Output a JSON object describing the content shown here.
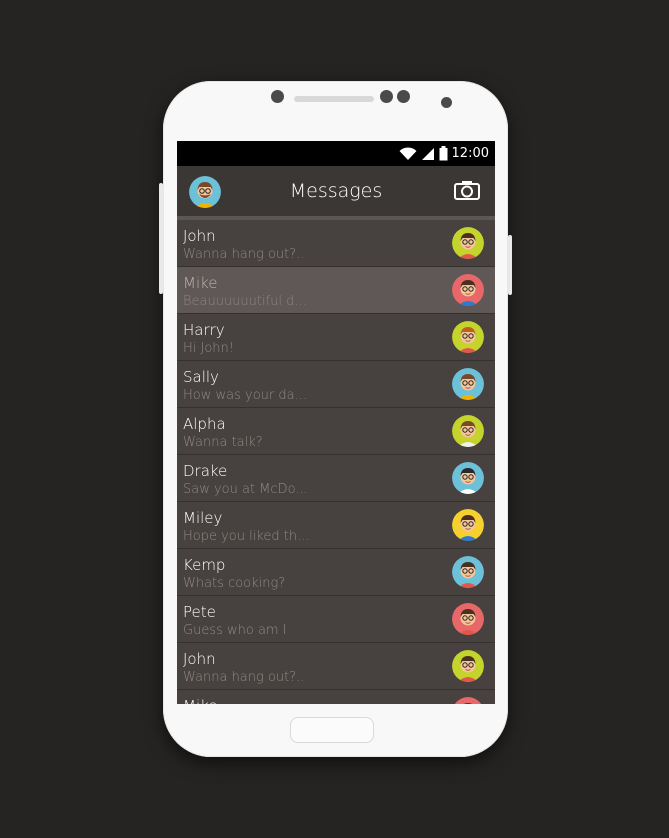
{
  "status_bar": {
    "time": "12:00"
  },
  "app_bar": {
    "title": "Messages",
    "profile_icon": "user-avatar",
    "camera_icon": "camera-icon"
  },
  "conversations": [
    {
      "name": "John",
      "preview": "Wanna hang out?..",
      "avatar_bg": "#c5d42c",
      "hair": "#4a3020",
      "shirt": "#e2574c",
      "selected": false
    },
    {
      "name": "Mike",
      "preview": "Beauuuuuutiful d...",
      "avatar_bg": "#e8686a",
      "hair": "#4a3020",
      "shirt": "#2f7ad1",
      "selected": true
    },
    {
      "name": "Harry",
      "preview": "Hi John!",
      "avatar_bg": "#c5d42c",
      "hair": "#c06020",
      "shirt": "#e2574c",
      "selected": false
    },
    {
      "name": "Sally",
      "preview": "How was your da...",
      "avatar_bg": "#6cc0d8",
      "hair": "#7a4a28",
      "shirt": "#f0b400",
      "selected": false
    },
    {
      "name": "Alpha",
      "preview": "Wanna talk?",
      "avatar_bg": "#c5d42c",
      "hair": "#7a4a28",
      "shirt": "#f0f0f0",
      "selected": false
    },
    {
      "name": "Drake",
      "preview": "Saw you at McDo...",
      "avatar_bg": "#6cc0d8",
      "hair": "#2a2a2a",
      "shirt": "#ffffff",
      "selected": false
    },
    {
      "name": "Miley",
      "preview": "Hope you liked th...",
      "avatar_bg": "#f6d02e",
      "hair": "#4a3020",
      "shirt": "#2f7ad1",
      "selected": false
    },
    {
      "name": "Kemp",
      "preview": "Whats cooking?",
      "avatar_bg": "#6cc0d8",
      "hair": "#4a3020",
      "shirt": "#e2574c",
      "selected": false
    },
    {
      "name": "Pete",
      "preview": "Guess who am I",
      "avatar_bg": "#e8686a",
      "hair": "#4a3020",
      "shirt": "#e2574c",
      "selected": false
    },
    {
      "name": "John",
      "preview": "Wanna hang out?..",
      "avatar_bg": "#c5d42c",
      "hair": "#4a3020",
      "shirt": "#e2574c",
      "selected": false
    },
    {
      "name": "Mike",
      "preview": "",
      "avatar_bg": "#e8686a",
      "hair": "#4a3020",
      "shirt": "#2f7ad1",
      "selected": false
    }
  ]
}
